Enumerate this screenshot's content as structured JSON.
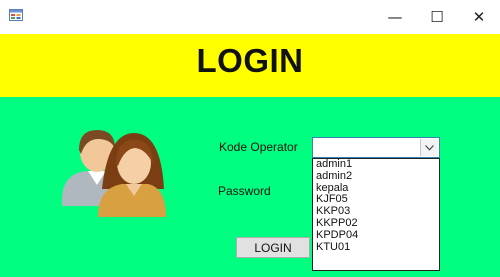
{
  "window": {
    "icon": "form-app-icon",
    "minimize_glyph": "—",
    "maximize_glyph": "☐",
    "close_glyph": "✕"
  },
  "header": {
    "title": "LOGIN",
    "background": "#ffff00"
  },
  "form": {
    "background": "#00ff80",
    "avatar_icon": "users-avatar-icon",
    "operator_label": "Kode Operator",
    "password_label": "Password",
    "operator_value": "",
    "dropdown_options": [
      "admin1",
      "admin2",
      "kepala",
      "KJF05",
      "KKP03",
      "KKPP02",
      "KPDP04",
      "KTU01"
    ],
    "login_button": "LOGIN"
  }
}
